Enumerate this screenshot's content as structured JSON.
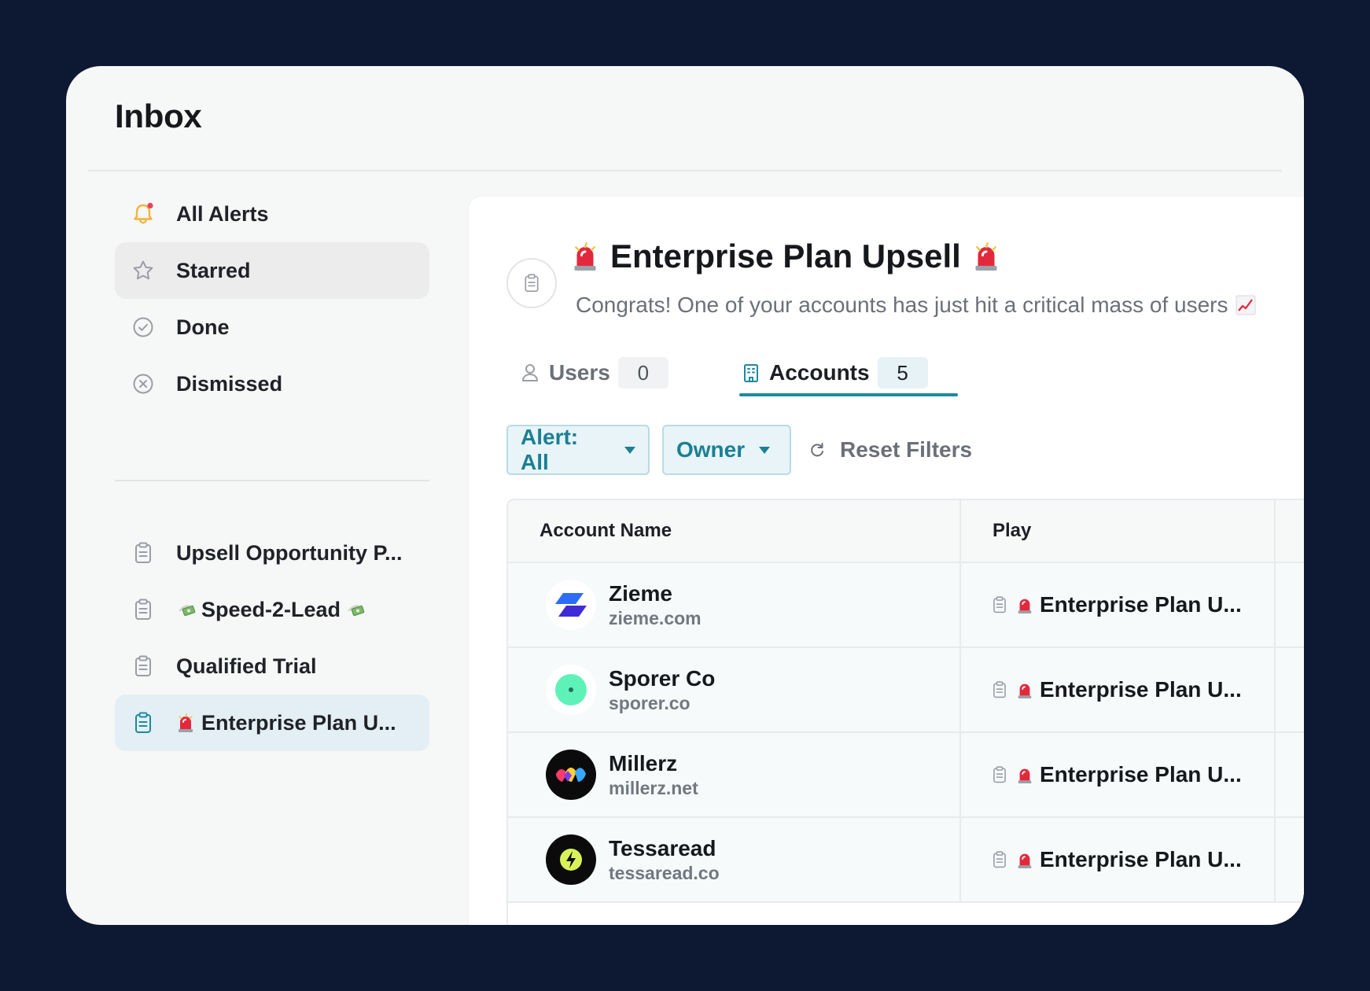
{
  "app": {
    "title": "Inbox"
  },
  "sidebar": {
    "views": [
      {
        "label": "All Alerts",
        "icon": "bell-icon"
      },
      {
        "label": "Starred",
        "icon": "star-icon"
      },
      {
        "label": "Done",
        "icon": "check-circle-icon"
      },
      {
        "label": "Dismissed",
        "icon": "x-circle-icon"
      }
    ],
    "plays": [
      {
        "label": "Upsell Opportunity P...",
        "icon": "clipboard-icon"
      },
      {
        "label": "Speed-2-Lead",
        "icon": "clipboard-icon",
        "emoji": "money-with-wings"
      },
      {
        "label": "Qualified Trial",
        "icon": "clipboard-icon"
      },
      {
        "label": "Enterprise Plan U...",
        "icon": "clipboard-icon",
        "emoji": "siren"
      }
    ]
  },
  "play": {
    "title": "Enterprise Plan Upsell",
    "subtitle": "Congrats! One of your accounts has just hit a critical mass of users",
    "title_emoji": "siren",
    "subtitle_emoji": "chart-increasing"
  },
  "tabs": [
    {
      "label": "Users",
      "count": "0",
      "icon": "user-icon"
    },
    {
      "label": "Accounts",
      "count": "5",
      "icon": "building-icon",
      "active": true
    }
  ],
  "filters": {
    "alert": "Alert: All",
    "owner": "Owner",
    "reset": "Reset Filters"
  },
  "table": {
    "columns": [
      "Account Name",
      "Play"
    ],
    "rows": [
      {
        "name": "Zieme",
        "domain": "zieme.com",
        "play": "Enterprise Plan U..."
      },
      {
        "name": "Sporer Co",
        "domain": "sporer.co",
        "play": "Enterprise Plan U..."
      },
      {
        "name": "Millerz",
        "domain": "millerz.net",
        "play": "Enterprise Plan U..."
      },
      {
        "name": "Tessaread",
        "domain": "tessaread.co",
        "play": "Enterprise Plan U..."
      }
    ]
  },
  "colors": {
    "background": "#0d1932",
    "card": "#f6f7f7",
    "accent": "#1b8aa0",
    "filter_bg": "#e8f4f7",
    "bell": "#f2b33d",
    "notification_dot": "#e8425a"
  }
}
